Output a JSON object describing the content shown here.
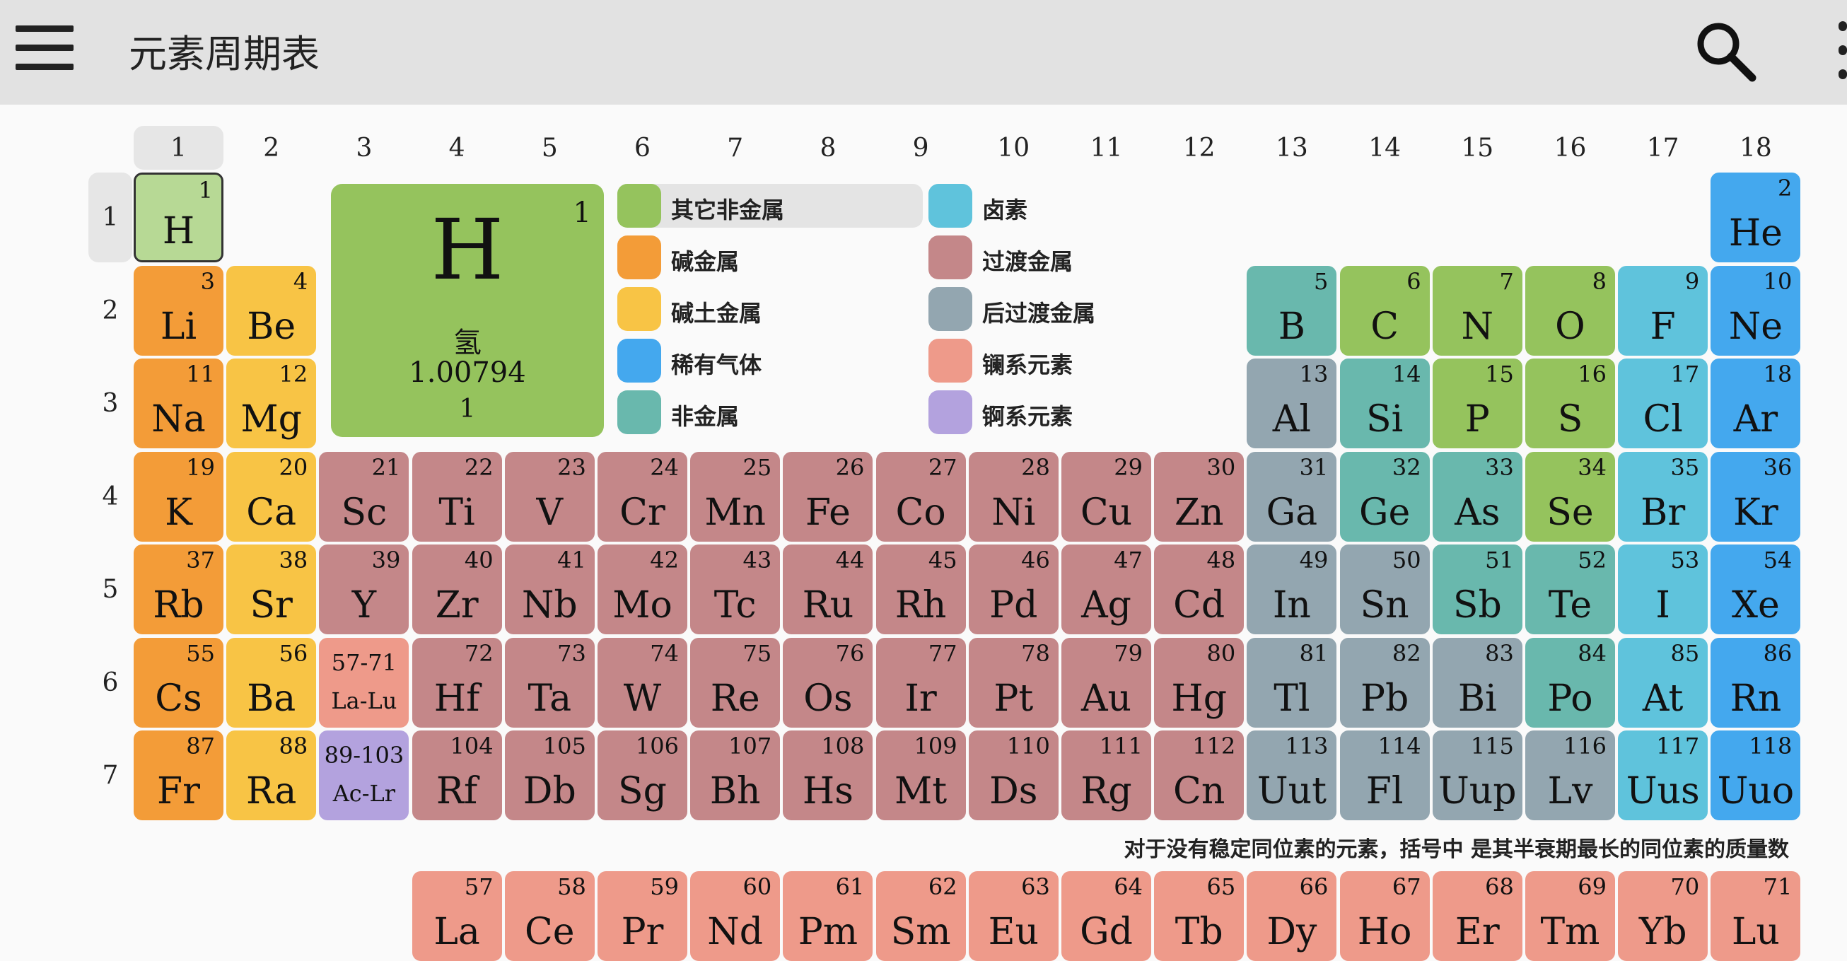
{
  "appbar": {
    "title": "元素周期表",
    "menu_icon": "menu-icon",
    "search_icon": "search-icon",
    "overflow_icon": "more-vert-icon"
  },
  "colors": {
    "other_nonmetal": "#95c35d",
    "alkali_metal": "#f39c38",
    "alkaline_earth": "#f8c445",
    "noble_gas": "#44a8ee",
    "nonmetal": "#69b8ad",
    "halogen": "#5fc3dc",
    "transition_metal": "#c48789",
    "post_transition": "#93a6b0",
    "lanthanide": "#ee9a8a",
    "actinide": "#b3a2de",
    "selected_light": "#b7d995"
  },
  "columns": [
    "1",
    "2",
    "3",
    "4",
    "5",
    "6",
    "7",
    "8",
    "9",
    "10",
    "11",
    "12",
    "13",
    "14",
    "15",
    "16",
    "17",
    "18"
  ],
  "rows": [
    "1",
    "2",
    "3",
    "4",
    "5",
    "6",
    "7"
  ],
  "selected_column": "1",
  "selected_row": "1",
  "detail": {
    "number": "1",
    "symbol": "H",
    "name": "氢",
    "mass": "1.00794",
    "valence": "1"
  },
  "legend": [
    {
      "label": "其它非金属",
      "cat": "other_nonmetal"
    },
    {
      "label": "碱金属",
      "cat": "alkali_metal"
    },
    {
      "label": "碱土金属",
      "cat": "alkaline_earth"
    },
    {
      "label": "稀有气体",
      "cat": "noble_gas"
    },
    {
      "label": "非金属",
      "cat": "nonmetal"
    },
    {
      "label": "卤素",
      "cat": "halogen"
    },
    {
      "label": "过渡金属",
      "cat": "transition_metal"
    },
    {
      "label": "后过渡金属",
      "cat": "post_transition"
    },
    {
      "label": "镧系元素",
      "cat": "lanthanide"
    },
    {
      "label": "锕系元素",
      "cat": "actinide"
    }
  ],
  "selected_legend": "其它非金属",
  "placeholders": [
    {
      "numbers": "57-71",
      "symbols": "La-Lu",
      "period": 6,
      "group": 3,
      "cat": "lanthanide"
    },
    {
      "numbers": "89-103",
      "symbols": "Ac-Lr",
      "period": 7,
      "group": 3,
      "cat": "actinide"
    }
  ],
  "elements": [
    {
      "n": "1",
      "s": "H",
      "p": 1,
      "g": 1,
      "c": "selected_light",
      "sel": true
    },
    {
      "n": "2",
      "s": "He",
      "p": 1,
      "g": 18,
      "c": "noble_gas"
    },
    {
      "n": "3",
      "s": "Li",
      "p": 2,
      "g": 1,
      "c": "alkali_metal"
    },
    {
      "n": "4",
      "s": "Be",
      "p": 2,
      "g": 2,
      "c": "alkaline_earth"
    },
    {
      "n": "5",
      "s": "B",
      "p": 2,
      "g": 13,
      "c": "nonmetal"
    },
    {
      "n": "6",
      "s": "C",
      "p": 2,
      "g": 14,
      "c": "other_nonmetal"
    },
    {
      "n": "7",
      "s": "N",
      "p": 2,
      "g": 15,
      "c": "other_nonmetal"
    },
    {
      "n": "8",
      "s": "O",
      "p": 2,
      "g": 16,
      "c": "other_nonmetal"
    },
    {
      "n": "9",
      "s": "F",
      "p": 2,
      "g": 17,
      "c": "halogen"
    },
    {
      "n": "10",
      "s": "Ne",
      "p": 2,
      "g": 18,
      "c": "noble_gas"
    },
    {
      "n": "11",
      "s": "Na",
      "p": 3,
      "g": 1,
      "c": "alkali_metal"
    },
    {
      "n": "12",
      "s": "Mg",
      "p": 3,
      "g": 2,
      "c": "alkaline_earth"
    },
    {
      "n": "13",
      "s": "Al",
      "p": 3,
      "g": 13,
      "c": "post_transition"
    },
    {
      "n": "14",
      "s": "Si",
      "p": 3,
      "g": 14,
      "c": "nonmetal"
    },
    {
      "n": "15",
      "s": "P",
      "p": 3,
      "g": 15,
      "c": "other_nonmetal"
    },
    {
      "n": "16",
      "s": "S",
      "p": 3,
      "g": 16,
      "c": "other_nonmetal"
    },
    {
      "n": "17",
      "s": "Cl",
      "p": 3,
      "g": 17,
      "c": "halogen"
    },
    {
      "n": "18",
      "s": "Ar",
      "p": 3,
      "g": 18,
      "c": "noble_gas"
    },
    {
      "n": "19",
      "s": "K",
      "p": 4,
      "g": 1,
      "c": "alkali_metal"
    },
    {
      "n": "20",
      "s": "Ca",
      "p": 4,
      "g": 2,
      "c": "alkaline_earth"
    },
    {
      "n": "21",
      "s": "Sc",
      "p": 4,
      "g": 3,
      "c": "transition_metal"
    },
    {
      "n": "22",
      "s": "Ti",
      "p": 4,
      "g": 4,
      "c": "transition_metal"
    },
    {
      "n": "23",
      "s": "V",
      "p": 4,
      "g": 5,
      "c": "transition_metal"
    },
    {
      "n": "24",
      "s": "Cr",
      "p": 4,
      "g": 6,
      "c": "transition_metal"
    },
    {
      "n": "25",
      "s": "Mn",
      "p": 4,
      "g": 7,
      "c": "transition_metal"
    },
    {
      "n": "26",
      "s": "Fe",
      "p": 4,
      "g": 8,
      "c": "transition_metal"
    },
    {
      "n": "27",
      "s": "Co",
      "p": 4,
      "g": 9,
      "c": "transition_metal"
    },
    {
      "n": "28",
      "s": "Ni",
      "p": 4,
      "g": 10,
      "c": "transition_metal"
    },
    {
      "n": "29",
      "s": "Cu",
      "p": 4,
      "g": 11,
      "c": "transition_metal"
    },
    {
      "n": "30",
      "s": "Zn",
      "p": 4,
      "g": 12,
      "c": "transition_metal"
    },
    {
      "n": "31",
      "s": "Ga",
      "p": 4,
      "g": 13,
      "c": "post_transition"
    },
    {
      "n": "32",
      "s": "Ge",
      "p": 4,
      "g": 14,
      "c": "nonmetal"
    },
    {
      "n": "33",
      "s": "As",
      "p": 4,
      "g": 15,
      "c": "nonmetal"
    },
    {
      "n": "34",
      "s": "Se",
      "p": 4,
      "g": 16,
      "c": "other_nonmetal"
    },
    {
      "n": "35",
      "s": "Br",
      "p": 4,
      "g": 17,
      "c": "halogen"
    },
    {
      "n": "36",
      "s": "Kr",
      "p": 4,
      "g": 18,
      "c": "noble_gas"
    },
    {
      "n": "37",
      "s": "Rb",
      "p": 5,
      "g": 1,
      "c": "alkali_metal"
    },
    {
      "n": "38",
      "s": "Sr",
      "p": 5,
      "g": 2,
      "c": "alkaline_earth"
    },
    {
      "n": "39",
      "s": "Y",
      "p": 5,
      "g": 3,
      "c": "transition_metal"
    },
    {
      "n": "40",
      "s": "Zr",
      "p": 5,
      "g": 4,
      "c": "transition_metal"
    },
    {
      "n": "41",
      "s": "Nb",
      "p": 5,
      "g": 5,
      "c": "transition_metal"
    },
    {
      "n": "42",
      "s": "Mo",
      "p": 5,
      "g": 6,
      "c": "transition_metal"
    },
    {
      "n": "43",
      "s": "Tc",
      "p": 5,
      "g": 7,
      "c": "transition_metal"
    },
    {
      "n": "44",
      "s": "Ru",
      "p": 5,
      "g": 8,
      "c": "transition_metal"
    },
    {
      "n": "45",
      "s": "Rh",
      "p": 5,
      "g": 9,
      "c": "transition_metal"
    },
    {
      "n": "46",
      "s": "Pd",
      "p": 5,
      "g": 10,
      "c": "transition_metal"
    },
    {
      "n": "47",
      "s": "Ag",
      "p": 5,
      "g": 11,
      "c": "transition_metal"
    },
    {
      "n": "48",
      "s": "Cd",
      "p": 5,
      "g": 12,
      "c": "transition_metal"
    },
    {
      "n": "49",
      "s": "In",
      "p": 5,
      "g": 13,
      "c": "post_transition"
    },
    {
      "n": "50",
      "s": "Sn",
      "p": 5,
      "g": 14,
      "c": "post_transition"
    },
    {
      "n": "51",
      "s": "Sb",
      "p": 5,
      "g": 15,
      "c": "nonmetal"
    },
    {
      "n": "52",
      "s": "Te",
      "p": 5,
      "g": 16,
      "c": "nonmetal"
    },
    {
      "n": "53",
      "s": "I",
      "p": 5,
      "g": 17,
      "c": "halogen"
    },
    {
      "n": "54",
      "s": "Xe",
      "p": 5,
      "g": 18,
      "c": "noble_gas"
    },
    {
      "n": "55",
      "s": "Cs",
      "p": 6,
      "g": 1,
      "c": "alkali_metal"
    },
    {
      "n": "56",
      "s": "Ba",
      "p": 6,
      "g": 2,
      "c": "alkaline_earth"
    },
    {
      "n": "72",
      "s": "Hf",
      "p": 6,
      "g": 4,
      "c": "transition_metal"
    },
    {
      "n": "73",
      "s": "Ta",
      "p": 6,
      "g": 5,
      "c": "transition_metal"
    },
    {
      "n": "74",
      "s": "W",
      "p": 6,
      "g": 6,
      "c": "transition_metal"
    },
    {
      "n": "75",
      "s": "Re",
      "p": 6,
      "g": 7,
      "c": "transition_metal"
    },
    {
      "n": "76",
      "s": "Os",
      "p": 6,
      "g": 8,
      "c": "transition_metal"
    },
    {
      "n": "77",
      "s": "Ir",
      "p": 6,
      "g": 9,
      "c": "transition_metal"
    },
    {
      "n": "78",
      "s": "Pt",
      "p": 6,
      "g": 10,
      "c": "transition_metal"
    },
    {
      "n": "79",
      "s": "Au",
      "p": 6,
      "g": 11,
      "c": "transition_metal"
    },
    {
      "n": "80",
      "s": "Hg",
      "p": 6,
      "g": 12,
      "c": "transition_metal"
    },
    {
      "n": "81",
      "s": "Tl",
      "p": 6,
      "g": 13,
      "c": "post_transition"
    },
    {
      "n": "82",
      "s": "Pb",
      "p": 6,
      "g": 14,
      "c": "post_transition"
    },
    {
      "n": "83",
      "s": "Bi",
      "p": 6,
      "g": 15,
      "c": "post_transition"
    },
    {
      "n": "84",
      "s": "Po",
      "p": 6,
      "g": 16,
      "c": "nonmetal"
    },
    {
      "n": "85",
      "s": "At",
      "p": 6,
      "g": 17,
      "c": "halogen"
    },
    {
      "n": "86",
      "s": "Rn",
      "p": 6,
      "g": 18,
      "c": "noble_gas"
    },
    {
      "n": "87",
      "s": "Fr",
      "p": 7,
      "g": 1,
      "c": "alkali_metal"
    },
    {
      "n": "88",
      "s": "Ra",
      "p": 7,
      "g": 2,
      "c": "alkaline_earth"
    },
    {
      "n": "104",
      "s": "Rf",
      "p": 7,
      "g": 4,
      "c": "transition_metal"
    },
    {
      "n": "105",
      "s": "Db",
      "p": 7,
      "g": 5,
      "c": "transition_metal"
    },
    {
      "n": "106",
      "s": "Sg",
      "p": 7,
      "g": 6,
      "c": "transition_metal"
    },
    {
      "n": "107",
      "s": "Bh",
      "p": 7,
      "g": 7,
      "c": "transition_metal"
    },
    {
      "n": "108",
      "s": "Hs",
      "p": 7,
      "g": 8,
      "c": "transition_metal"
    },
    {
      "n": "109",
      "s": "Mt",
      "p": 7,
      "g": 9,
      "c": "transition_metal"
    },
    {
      "n": "110",
      "s": "Ds",
      "p": 7,
      "g": 10,
      "c": "transition_metal"
    },
    {
      "n": "111",
      "s": "Rg",
      "p": 7,
      "g": 11,
      "c": "transition_metal"
    },
    {
      "n": "112",
      "s": "Cn",
      "p": 7,
      "g": 12,
      "c": "transition_metal"
    },
    {
      "n": "113",
      "s": "Uut",
      "p": 7,
      "g": 13,
      "c": "post_transition"
    },
    {
      "n": "114",
      "s": "Fl",
      "p": 7,
      "g": 14,
      "c": "post_transition"
    },
    {
      "n": "115",
      "s": "Uup",
      "p": 7,
      "g": 15,
      "c": "post_transition"
    },
    {
      "n": "116",
      "s": "Lv",
      "p": 7,
      "g": 16,
      "c": "post_transition"
    },
    {
      "n": "117",
      "s": "Uus",
      "p": 7,
      "g": 17,
      "c": "halogen"
    },
    {
      "n": "118",
      "s": "Uuo",
      "p": 7,
      "g": 18,
      "c": "noble_gas"
    }
  ],
  "lanthanides": [
    {
      "n": "57",
      "s": "La"
    },
    {
      "n": "58",
      "s": "Ce"
    },
    {
      "n": "59",
      "s": "Pr"
    },
    {
      "n": "60",
      "s": "Nd"
    },
    {
      "n": "61",
      "s": "Pm"
    },
    {
      "n": "62",
      "s": "Sm"
    },
    {
      "n": "63",
      "s": "Eu"
    },
    {
      "n": "64",
      "s": "Gd"
    },
    {
      "n": "65",
      "s": "Tb"
    },
    {
      "n": "66",
      "s": "Dy"
    },
    {
      "n": "67",
      "s": "Ho"
    },
    {
      "n": "68",
      "s": "Er"
    },
    {
      "n": "69",
      "s": "Tm"
    },
    {
      "n": "70",
      "s": "Yb"
    },
    {
      "n": "71",
      "s": "Lu"
    }
  ],
  "note": "对于没有稳定同位素的元素，括号中 是其半衰期最长的同位素的质量数"
}
